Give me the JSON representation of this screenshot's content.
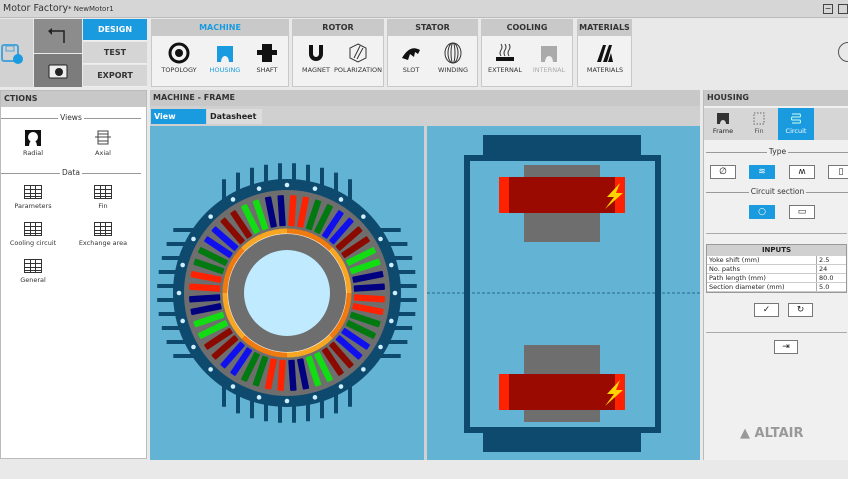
{
  "window": {
    "app_title": "Motor Factory",
    "document": "* NewMotor1"
  },
  "modes": {
    "design": "DESIGN",
    "test": "TEST",
    "export": "EXPORT"
  },
  "groups": [
    {
      "title": "MACHINE",
      "tools": [
        "TOPOLOGY",
        "HOUSING",
        "SHAFT"
      ]
    },
    {
      "title": "ROTOR",
      "tools": [
        "MAGNET",
        "POLARIZATION"
      ]
    },
    {
      "title": "STATOR",
      "tools": [
        "SLOT",
        "WINDING"
      ]
    },
    {
      "title": "COOLING",
      "tools": [
        "EXTERNAL",
        "INTERNAL"
      ]
    },
    {
      "title": "MATERIALS",
      "tools": [
        "MATERIALS"
      ]
    }
  ],
  "left": {
    "title": "CTIONS",
    "views_label": "Views",
    "views": [
      "Radial",
      "Axial"
    ],
    "data_label": "Data",
    "data": [
      "Parameters",
      "Fin",
      "Cooling circuit",
      "Exchange area",
      "General"
    ]
  },
  "center": {
    "title": "MACHINE - FRAME",
    "tabs": [
      "View",
      "Datasheet"
    ],
    "winding_colors": [
      "#ff2200",
      "#007a10",
      "#1010ee",
      "#8a0a00",
      "#12dd12",
      "#000080"
    ]
  },
  "right": {
    "title": "HOUSING",
    "tabs": [
      "Frame",
      "Fin",
      "Circuit"
    ],
    "type_label": "Type",
    "section_label": "Circuit section",
    "inputs_title": "INPUTS",
    "inputs": [
      {
        "label": "Yoke shift (mm)",
        "value": "2.5"
      },
      {
        "label": "No. paths",
        "value": "24"
      },
      {
        "label": "Path length (mm)",
        "value": "80.0"
      },
      {
        "label": "Section diameter (mm)",
        "value": "5.0"
      }
    ],
    "brand": "ALTAIR"
  }
}
